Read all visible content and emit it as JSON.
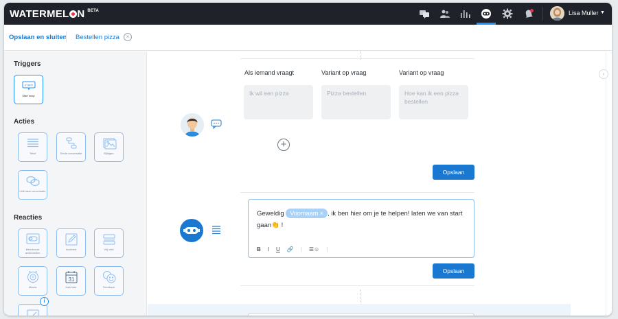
{
  "app": {
    "logo": "WATERMEL",
    "logo_tail": "N",
    "beta": "BETA",
    "user_name": "Lisa Muller"
  },
  "colors": {
    "topbar": "#1f2229",
    "accent": "#1a78d0",
    "tile_border": "#8bbdf0"
  },
  "topnav": {
    "icons": [
      "chat-bubbles-icon",
      "users-icon",
      "bar-chart-icon",
      "bot-icon",
      "gear-icon",
      "notification-bell-icon"
    ],
    "active": "bot-icon"
  },
  "subbar": {
    "save_close": "Opslaan en sluiten",
    "flow_name": "Bestellen pizza",
    "close_symbol": "×"
  },
  "sidebar": {
    "triggers_title": "Triggers",
    "triggers": [
      {
        "label": "Start knop",
        "icon_text": "START"
      }
    ],
    "actions_title": "Acties",
    "actions": [
      {
        "label": "Tekst"
      },
      {
        "label": "Einde conversatie"
      },
      {
        "label": "Bijlagen"
      },
      {
        "label": "Link naar conversatie"
      }
    ],
    "reactions_title": "Reacties",
    "reactions": [
      {
        "label": "Meerkeuze antwoorden"
      },
      {
        "label": "Invulveld"
      },
      {
        "label": "Vrij veld"
      },
      {
        "label": "Minuts"
      },
      {
        "label": "Kalender",
        "icon_text": "31"
      },
      {
        "label": "Feedback"
      }
    ],
    "info_badge": "i"
  },
  "canvas": {
    "question_block": {
      "headers": [
        "Als iemand vraagt",
        "Variant op vraag",
        "Variant op vraag"
      ],
      "placeholders": [
        "Ik wil een pizza",
        "Pizza bestellen",
        "Hoe kan ik een pizza bestellen"
      ],
      "add_symbol": "+",
      "save_label": "Opslaan"
    },
    "message_block": {
      "text_before": "Geweldig ",
      "chip_label": "Voornaam ×",
      "text_after": ", ik ben hier om je te helpen! laten we van start gaan",
      "emoji": "👏",
      "text_end": " !",
      "toolbar": [
        "B",
        "I",
        "U",
        "🔗",
        "|",
        "☰☺",
        "|"
      ],
      "save_label": "Opslaan"
    },
    "collapse_symbol": "‹"
  }
}
